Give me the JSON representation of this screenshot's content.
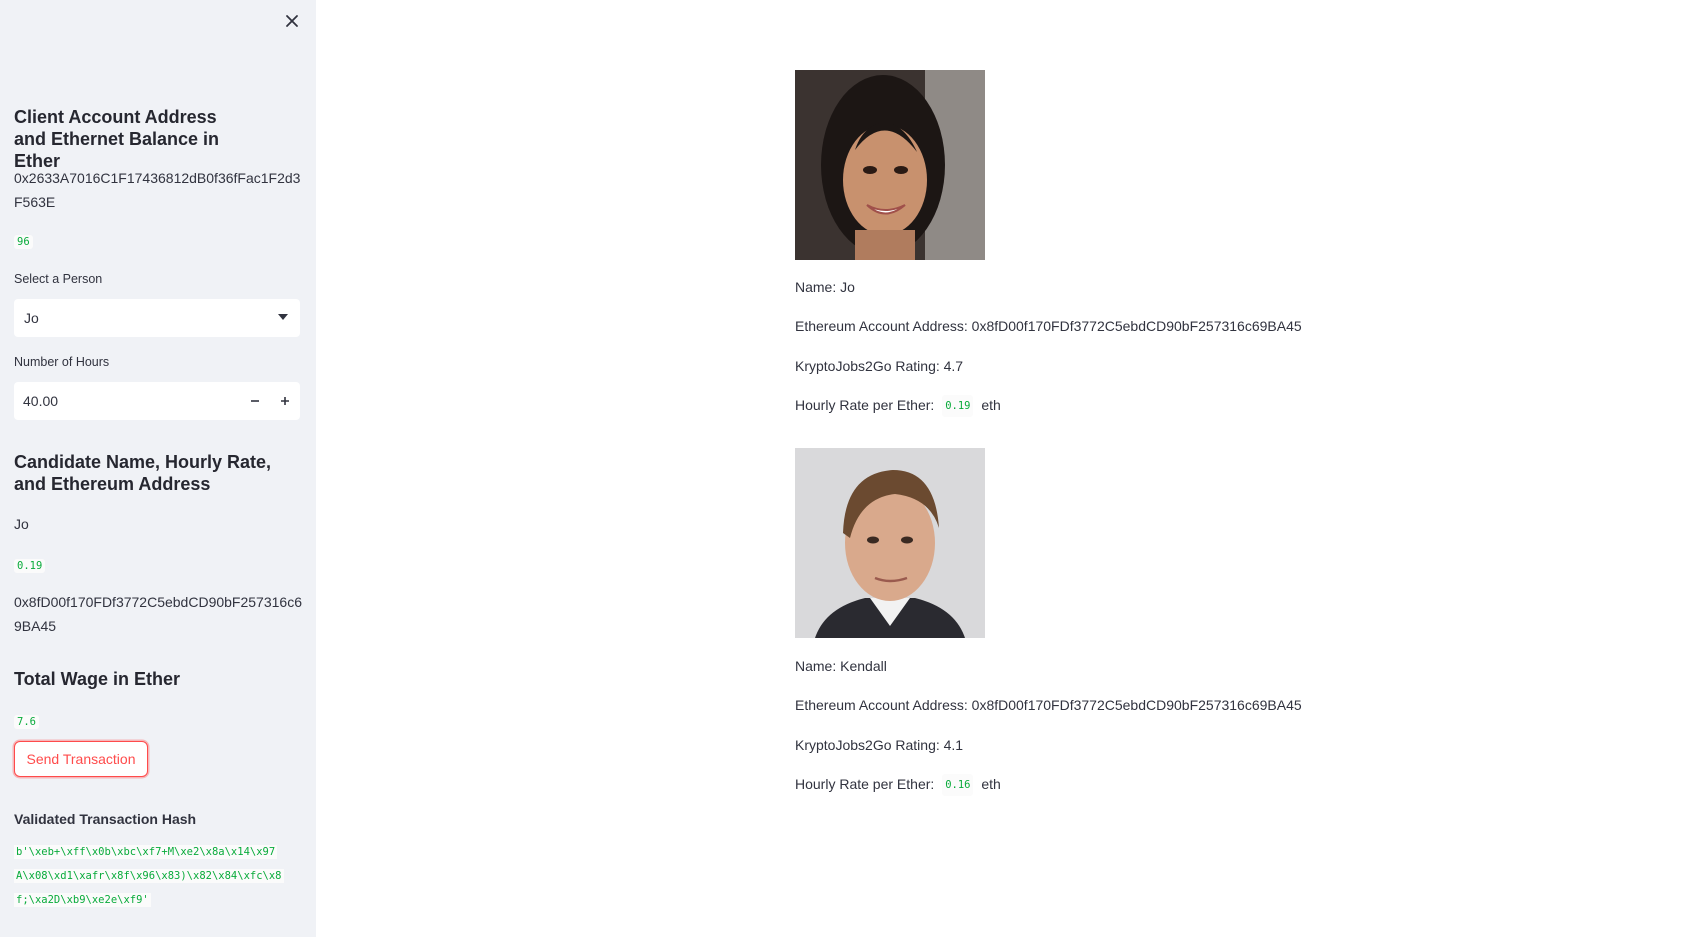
{
  "sidebar": {
    "client_heading": "Client Account Address and Ethernet Balance in Ether",
    "client_address": "0x2633A7016C1F17436812dB0f36fFac1F2d3F563E",
    "client_balance": "96",
    "select_label": "Select a Person",
    "selected_person": "Jo",
    "hours_label": "Number of Hours",
    "hours_value": "40.00",
    "candidate_heading": "Candidate Name, Hourly Rate, and Ethereum Address",
    "candidate_name": "Jo",
    "candidate_rate": "0.19",
    "candidate_address": "0x8fD00f170FDf3772C5ebdCD90bF257316c69BA45",
    "wage_heading": "Total Wage in Ether",
    "wage_value": "7.6",
    "send_button": "Send Transaction",
    "hash_heading": "Validated Transaction Hash",
    "hash_lines": [
      "b'\\xeb+\\xff\\x0b\\xbc\\xf7+M\\xe2\\x8a\\x14\\x97",
      "A\\x08\\xd1\\xafr\\x8f\\x96\\x83)\\x82\\x84\\xfc\\x8",
      "f;\\xa2D\\xb9\\xe2e\\xf9'"
    ]
  },
  "candidates": [
    {
      "name": "Name: Jo",
      "address": "Ethereum Account Address: 0x8fD00f170FDf3772C5ebdCD90bF257316c69BA45",
      "rating": "KryptoJobs2Go Rating: 4.7",
      "rate_label": "Hourly Rate per Ether:",
      "rate": "0.19",
      "unit": "eth"
    },
    {
      "name": "Name: Kendall",
      "address": "Ethereum Account Address: 0x8fD00f170FDf3772C5ebdCD90bF257316c69BA45",
      "rating": "KryptoJobs2Go Rating: 4.1",
      "rate_label": "Hourly Rate per Ether:",
      "rate": "0.16",
      "unit": "eth"
    }
  ],
  "colors": {
    "sidebar_bg": "#f0f2f6",
    "accent": "#ff4b4b",
    "code_green": "#09ab3b"
  }
}
